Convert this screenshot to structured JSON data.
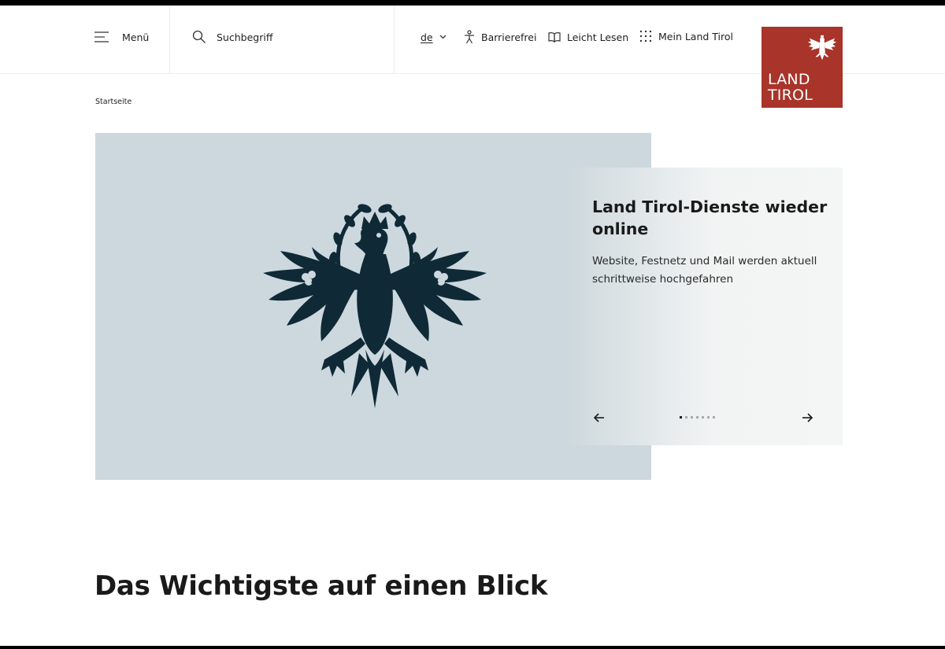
{
  "header": {
    "menu_label": "Menü",
    "search_placeholder": "Suchbegriff",
    "language": "de",
    "accessibility_label": "Barrierefrei",
    "easy_read_label": "Leicht Lesen",
    "my_account_label": "Mein Land Tirol"
  },
  "logo": {
    "line1": "LAND",
    "line2": "TIROL",
    "brand_color": "#a8342a"
  },
  "breadcrumb": {
    "home": "Startseite"
  },
  "hero": {
    "image": "tirol-eagle-coat-of-arms",
    "background_color": "#ccd8de",
    "eagle_color": "#0f2a36"
  },
  "slider": {
    "title": "Land Tirol-Dienste wieder online",
    "text": "Website, Festnetz und Mail werden aktuell schrittweise hochgefahren",
    "total_slides": 7,
    "active_index": 0
  },
  "section": {
    "title": "Das Wichtigste auf einen Blick"
  }
}
